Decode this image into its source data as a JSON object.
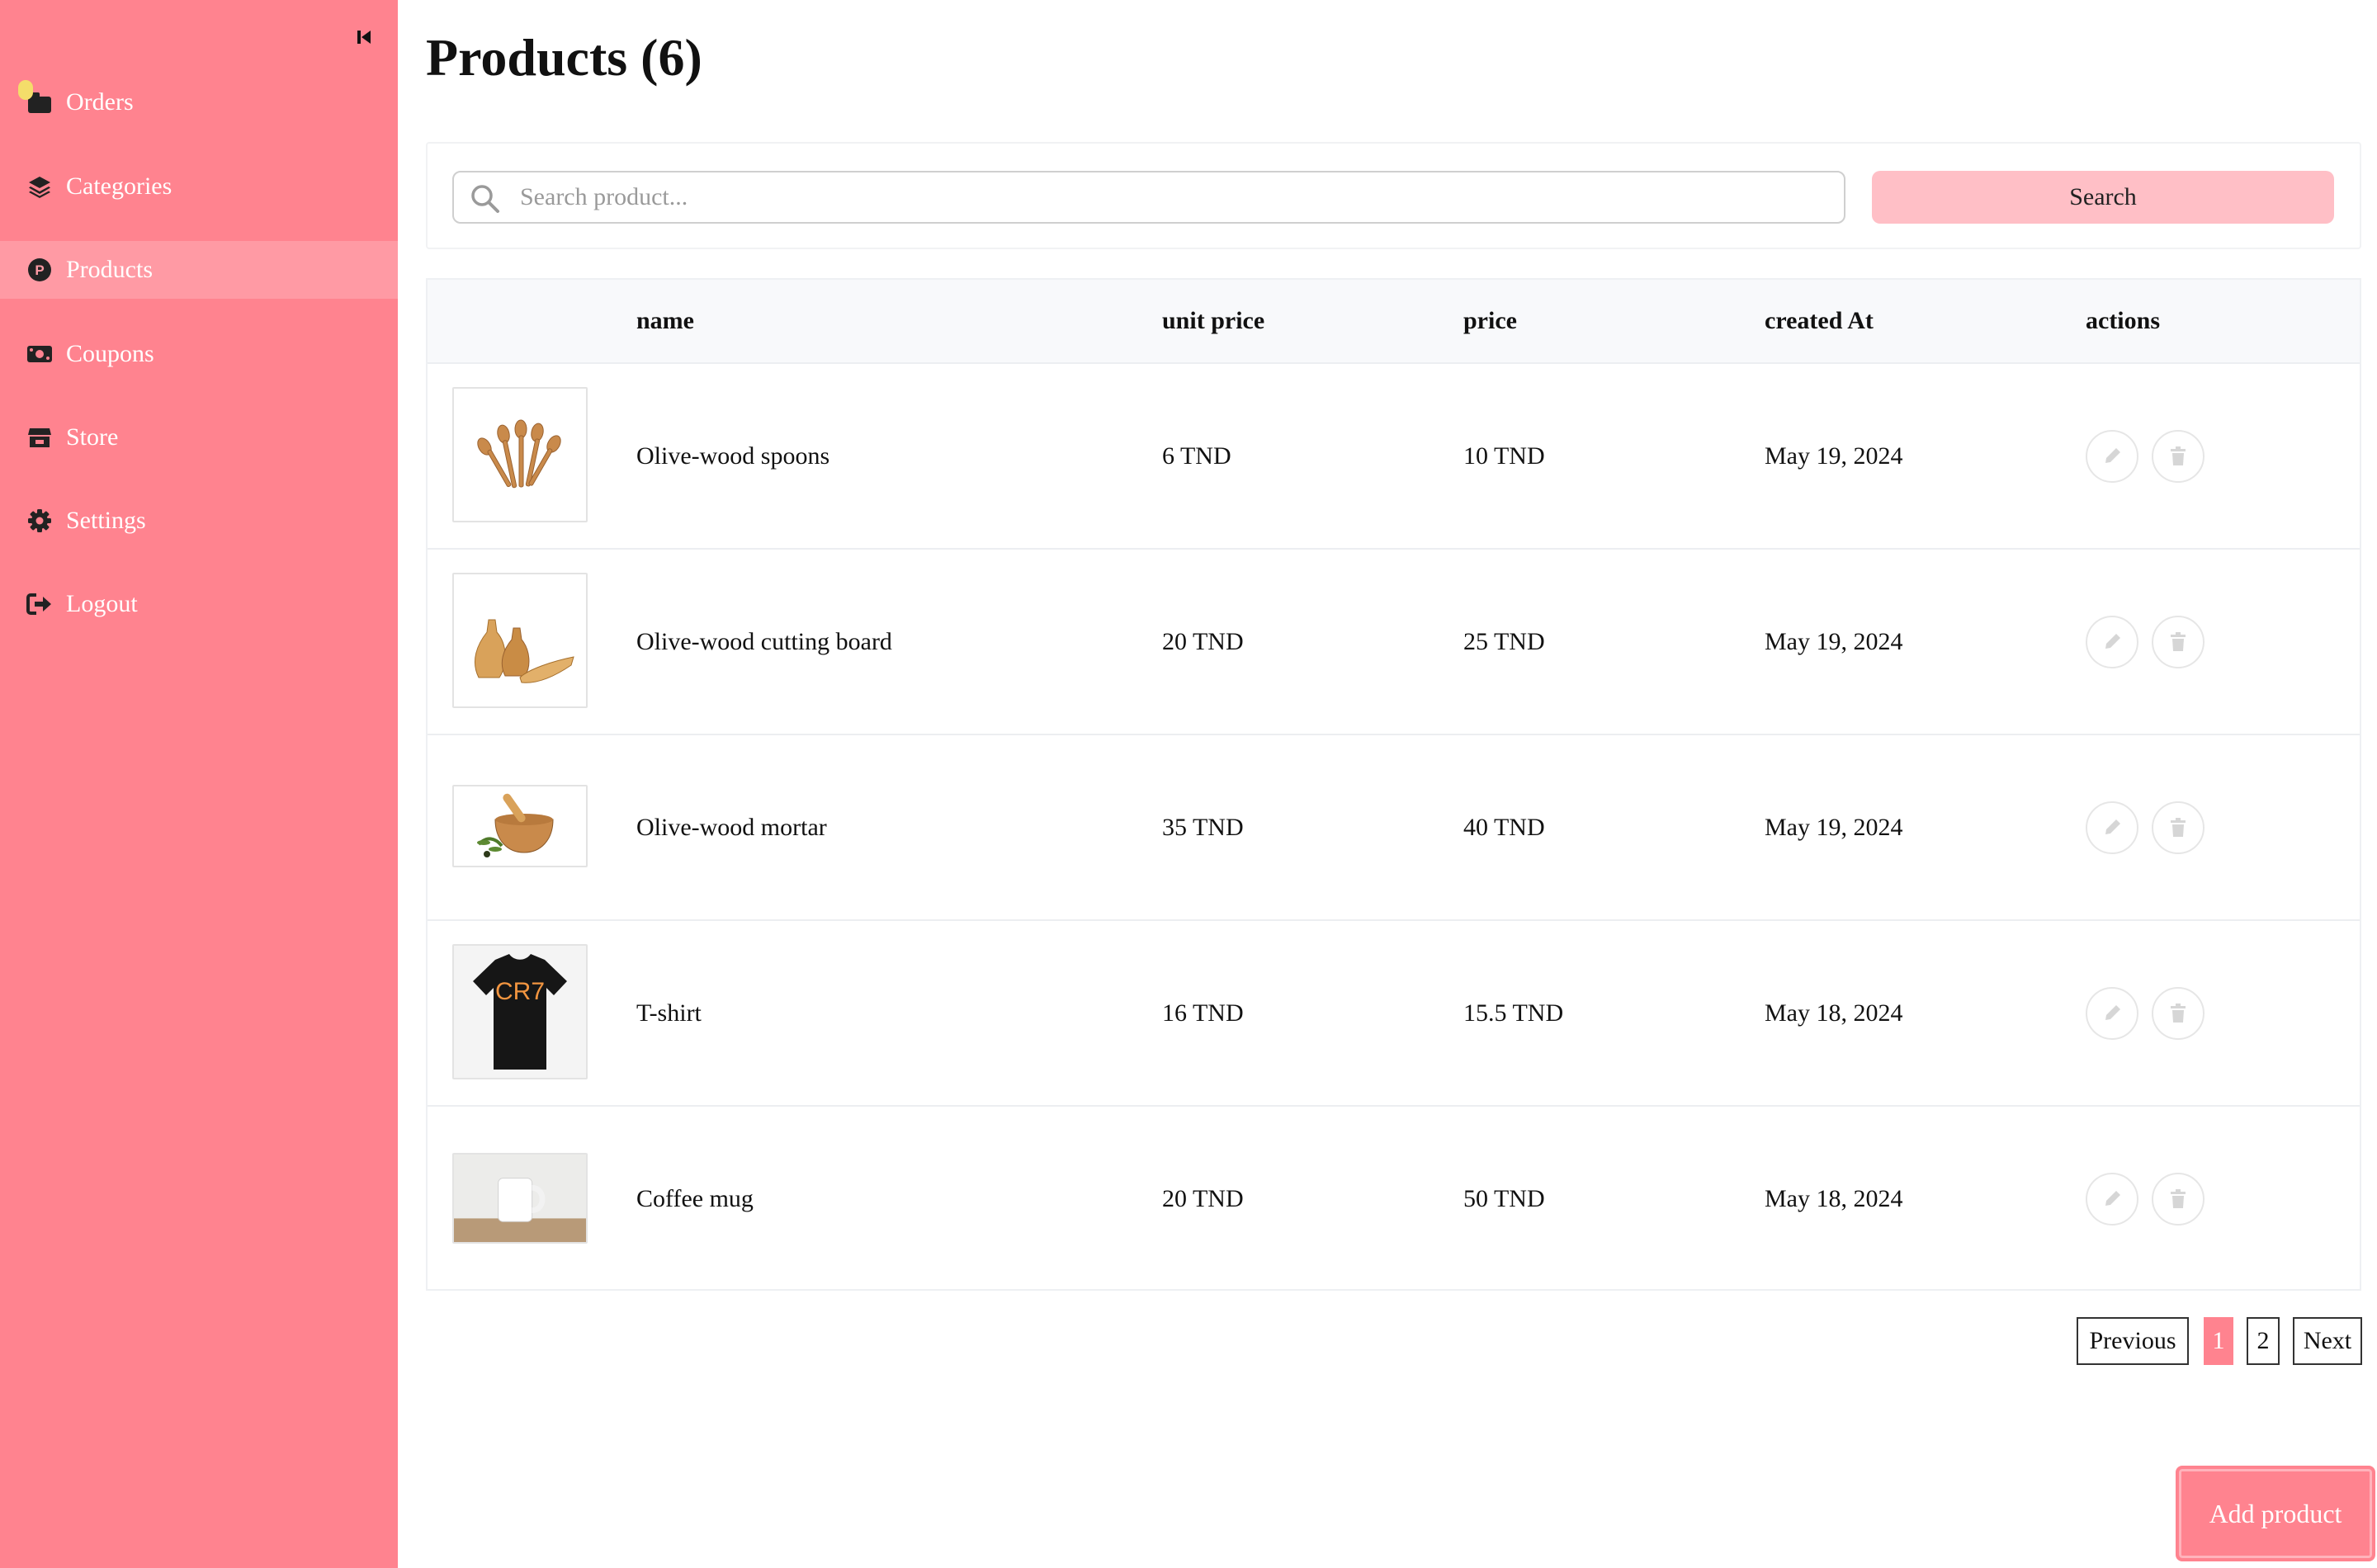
{
  "sidebar": {
    "items": [
      {
        "label": "Orders",
        "icon": "orders-icon"
      },
      {
        "label": "Categories",
        "icon": "layers-icon"
      },
      {
        "label": "Products",
        "icon": "product-p-icon",
        "active": true
      },
      {
        "label": "Coupons",
        "icon": "money-icon"
      },
      {
        "label": "Store",
        "icon": "store-icon"
      },
      {
        "label": "Settings",
        "icon": "gear-icon"
      },
      {
        "label": "Logout",
        "icon": "logout-icon"
      }
    ]
  },
  "page": {
    "title": "Products (6)"
  },
  "search": {
    "placeholder": "Search product...",
    "value": "",
    "button_label": "Search"
  },
  "table": {
    "headers": [
      "name",
      "unit price",
      "price",
      "created At",
      "actions"
    ],
    "rows": [
      {
        "name": "Olive-wood spoons",
        "unit_price": "6 TND",
        "price": "10 TND",
        "created_at": "May 19, 2024",
        "thumbnail": "spoons"
      },
      {
        "name": "Olive-wood cutting board",
        "unit_price": "20 TND",
        "price": "25 TND",
        "created_at": "May 19, 2024",
        "thumbnail": "cutting-board"
      },
      {
        "name": "Olive-wood mortar",
        "unit_price": "35 TND",
        "price": "40 TND",
        "created_at": "May 19, 2024",
        "thumbnail": "mortar"
      },
      {
        "name": "T-shirt",
        "unit_price": "16 TND",
        "price": "15.5 TND",
        "created_at": "May 18, 2024",
        "thumbnail": "tshirt",
        "thumbnail_text": "CR7"
      },
      {
        "name": "Coffee mug",
        "unit_price": "20 TND",
        "price": "50 TND",
        "created_at": "May 18, 2024",
        "thumbnail": "mug"
      }
    ]
  },
  "pagination": {
    "previous": "Previous",
    "pages": [
      "1",
      "2"
    ],
    "current": "1",
    "next": "Next"
  },
  "add_button": {
    "label": "Add product"
  },
  "colors": {
    "sidebar": "#ff838f",
    "sidebar_active": "#ff9aa4",
    "search_button": "#ffbfc6",
    "accent": "#ff838f"
  }
}
